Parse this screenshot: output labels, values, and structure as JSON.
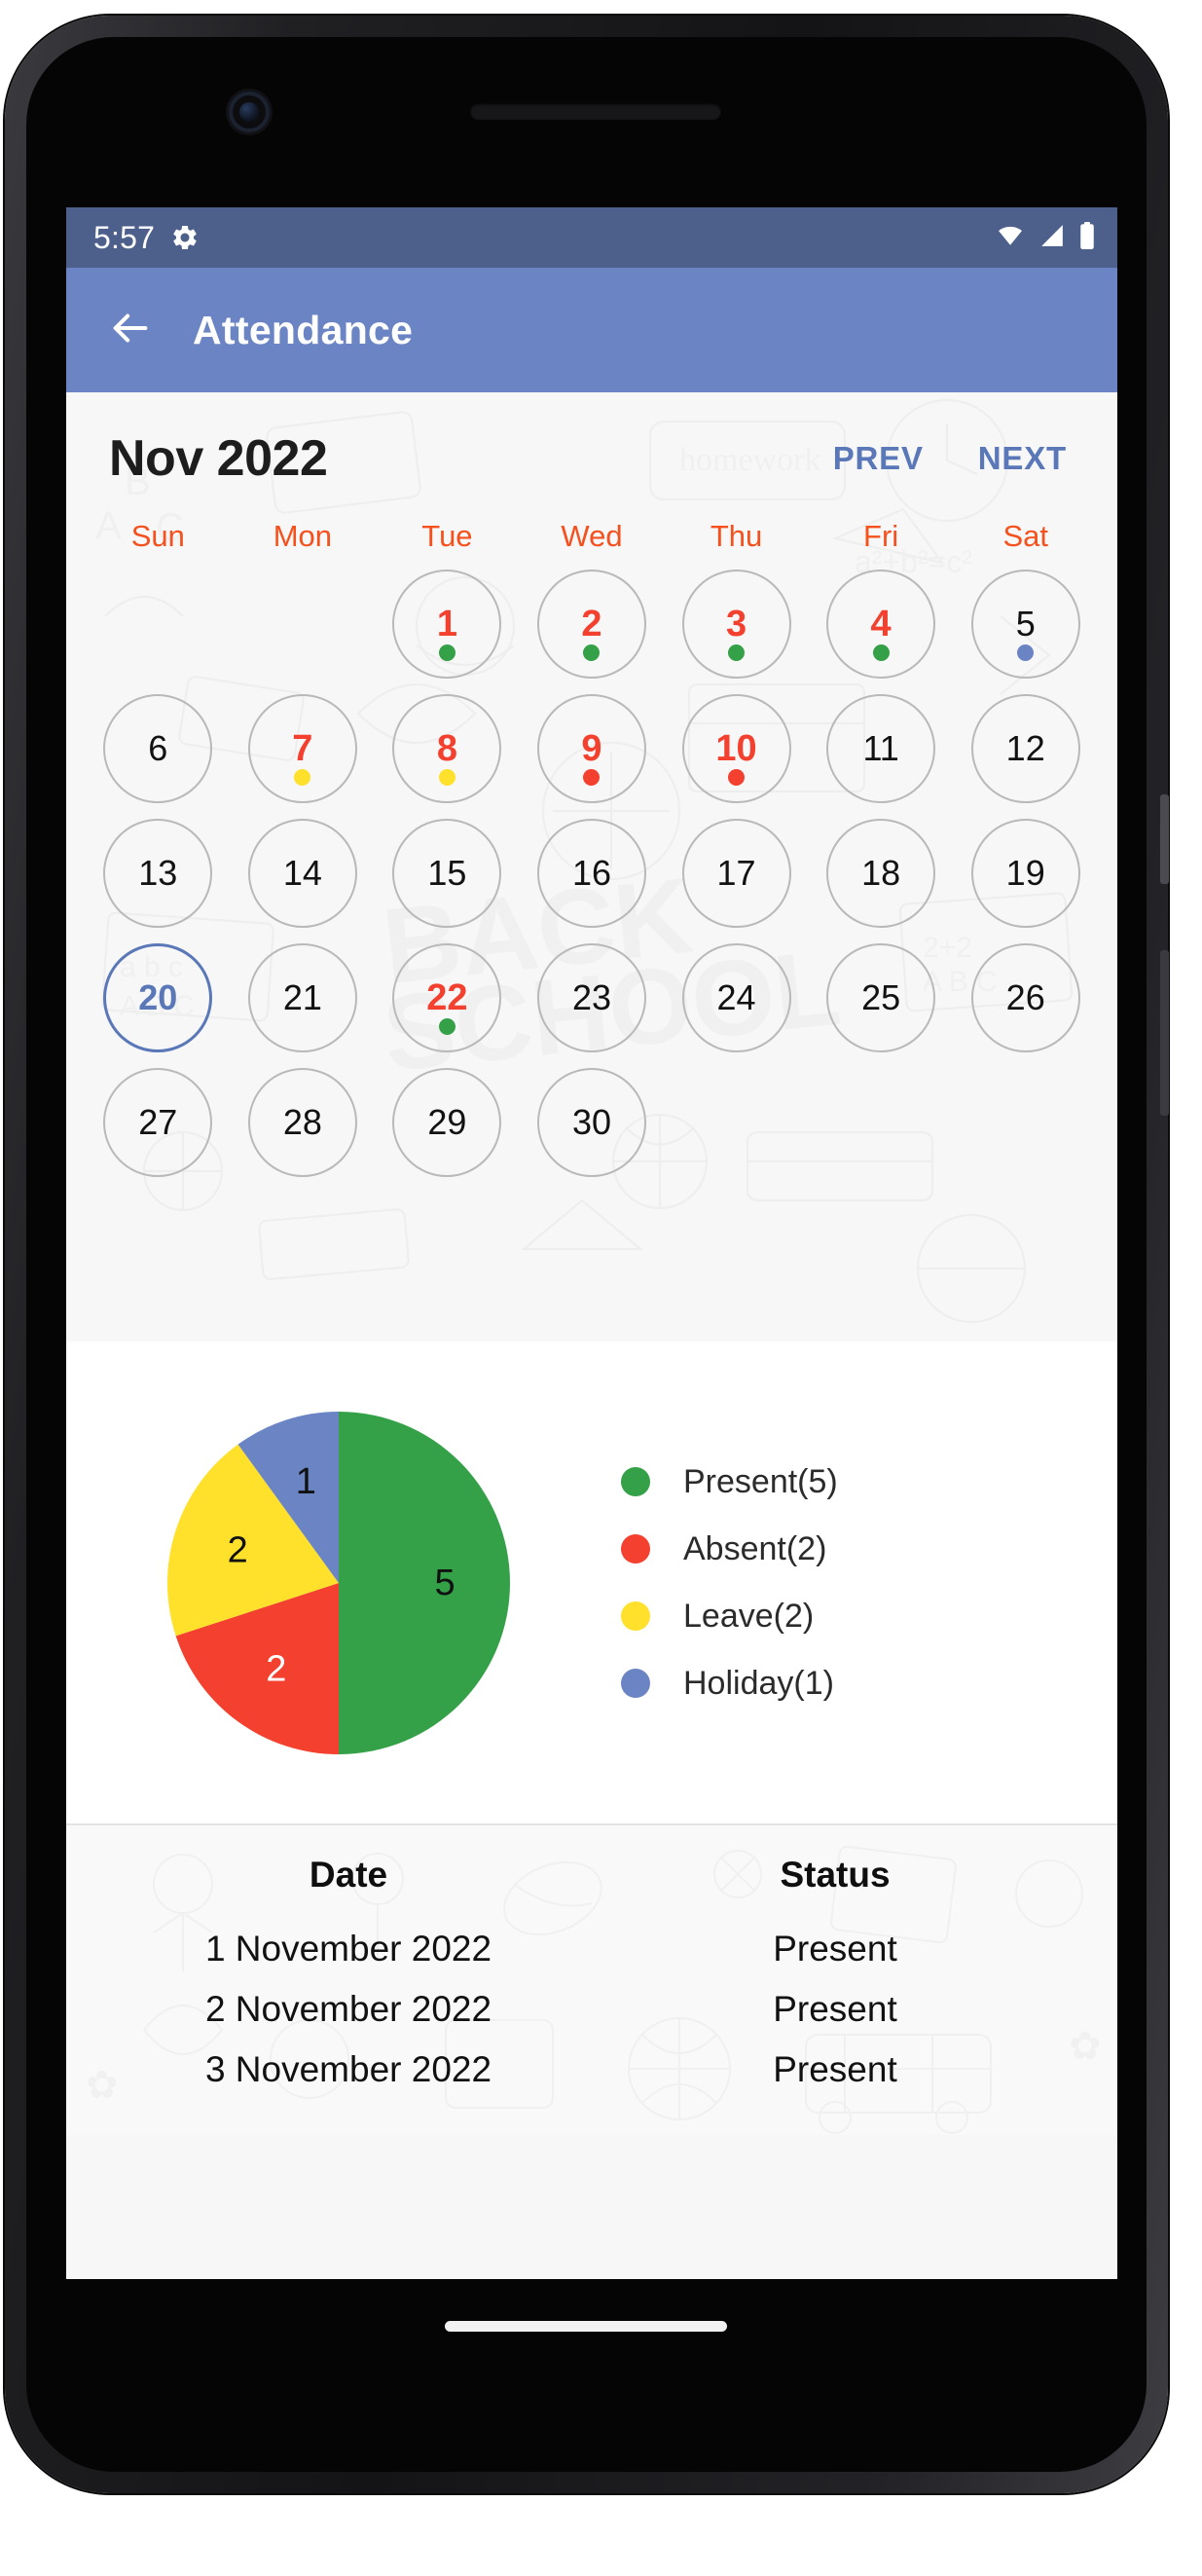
{
  "statusbar": {
    "time": "5:57",
    "icons": [
      "gear-icon",
      "wifi-icon",
      "signal-icon",
      "battery-icon"
    ]
  },
  "appbar": {
    "back_icon": "arrow-left-icon",
    "title": "Attendance"
  },
  "calendar": {
    "month_label": "Nov 2022",
    "prev_label": "PREV",
    "next_label": "NEXT",
    "weekdays": [
      "Sun",
      "Mon",
      "Tue",
      "Wed",
      "Thu",
      "Fri",
      "Sat"
    ],
    "weekday_color": "#f4511e",
    "marked_color": "#f4402e",
    "selected_color": "#5a77b8",
    "dot_colors": {
      "present": "#34a047",
      "absent": "#f4402e",
      "leave": "#ffe02b",
      "holiday": "#6b84c4"
    },
    "weeks": [
      [
        {
          "day": "",
          "state": "empty"
        },
        {
          "day": "",
          "state": "empty"
        },
        {
          "day": "1",
          "state": "marked",
          "dot": "present"
        },
        {
          "day": "2",
          "state": "marked",
          "dot": "present"
        },
        {
          "day": "3",
          "state": "marked",
          "dot": "present"
        },
        {
          "day": "4",
          "state": "marked",
          "dot": "present"
        },
        {
          "day": "5",
          "state": "normal",
          "dot": "holiday"
        }
      ],
      [
        {
          "day": "6",
          "state": "normal",
          "dot": ""
        },
        {
          "day": "7",
          "state": "marked",
          "dot": "leave"
        },
        {
          "day": "8",
          "state": "marked",
          "dot": "leave"
        },
        {
          "day": "9",
          "state": "marked",
          "dot": "absent"
        },
        {
          "day": "10",
          "state": "marked",
          "dot": "absent"
        },
        {
          "day": "11",
          "state": "normal",
          "dot": ""
        },
        {
          "day": "12",
          "state": "normal",
          "dot": ""
        }
      ],
      [
        {
          "day": "13",
          "state": "normal",
          "dot": ""
        },
        {
          "day": "14",
          "state": "normal",
          "dot": ""
        },
        {
          "day": "15",
          "state": "normal",
          "dot": ""
        },
        {
          "day": "16",
          "state": "normal",
          "dot": ""
        },
        {
          "day": "17",
          "state": "normal",
          "dot": ""
        },
        {
          "day": "18",
          "state": "normal",
          "dot": ""
        },
        {
          "day": "19",
          "state": "normal",
          "dot": ""
        }
      ],
      [
        {
          "day": "20",
          "state": "selected",
          "dot": ""
        },
        {
          "day": "21",
          "state": "normal",
          "dot": ""
        },
        {
          "day": "22",
          "state": "marked",
          "dot": "present"
        },
        {
          "day": "23",
          "state": "normal",
          "dot": ""
        },
        {
          "day": "24",
          "state": "normal",
          "dot": ""
        },
        {
          "day": "25",
          "state": "normal",
          "dot": ""
        },
        {
          "day": "26",
          "state": "normal",
          "dot": ""
        }
      ],
      [
        {
          "day": "27",
          "state": "normal",
          "dot": ""
        },
        {
          "day": "28",
          "state": "normal",
          "dot": ""
        },
        {
          "day": "29",
          "state": "normal",
          "dot": ""
        },
        {
          "day": "30",
          "state": "normal",
          "dot": ""
        },
        {
          "day": "",
          "state": "empty"
        },
        {
          "day": "",
          "state": "empty"
        },
        {
          "day": "",
          "state": "empty"
        }
      ]
    ]
  },
  "chart_data": {
    "type": "pie",
    "title": "",
    "categories": [
      "Present",
      "Absent",
      "Leave",
      "Holiday"
    ],
    "values": [
      5,
      2,
      2,
      1
    ],
    "colors": [
      "#34a047",
      "#f4402e",
      "#ffe02b",
      "#6b84c4"
    ],
    "slice_labels": [
      "5",
      "2",
      "2",
      "1"
    ],
    "slice_label_colors": [
      "#111111",
      "#ffffff",
      "#111111",
      "#111111"
    ],
    "legend": [
      {
        "label": "Present(5)",
        "color": "#34a047"
      },
      {
        "label": "Absent(2)",
        "color": "#f4402e"
      },
      {
        "label": "Leave(2)",
        "color": "#ffe02b"
      },
      {
        "label": "Holiday(1)",
        "color": "#6b84c4"
      }
    ],
    "legend_position": "right",
    "start_angle_deg": -90,
    "direction": "clockwise",
    "total": 10
  },
  "table": {
    "headers": [
      "Date",
      "Status"
    ],
    "rows": [
      {
        "date": "1 November 2022",
        "status": "Present"
      },
      {
        "date": "2 November 2022",
        "status": "Present"
      },
      {
        "date": "3 November 2022",
        "status": "Present"
      }
    ]
  }
}
